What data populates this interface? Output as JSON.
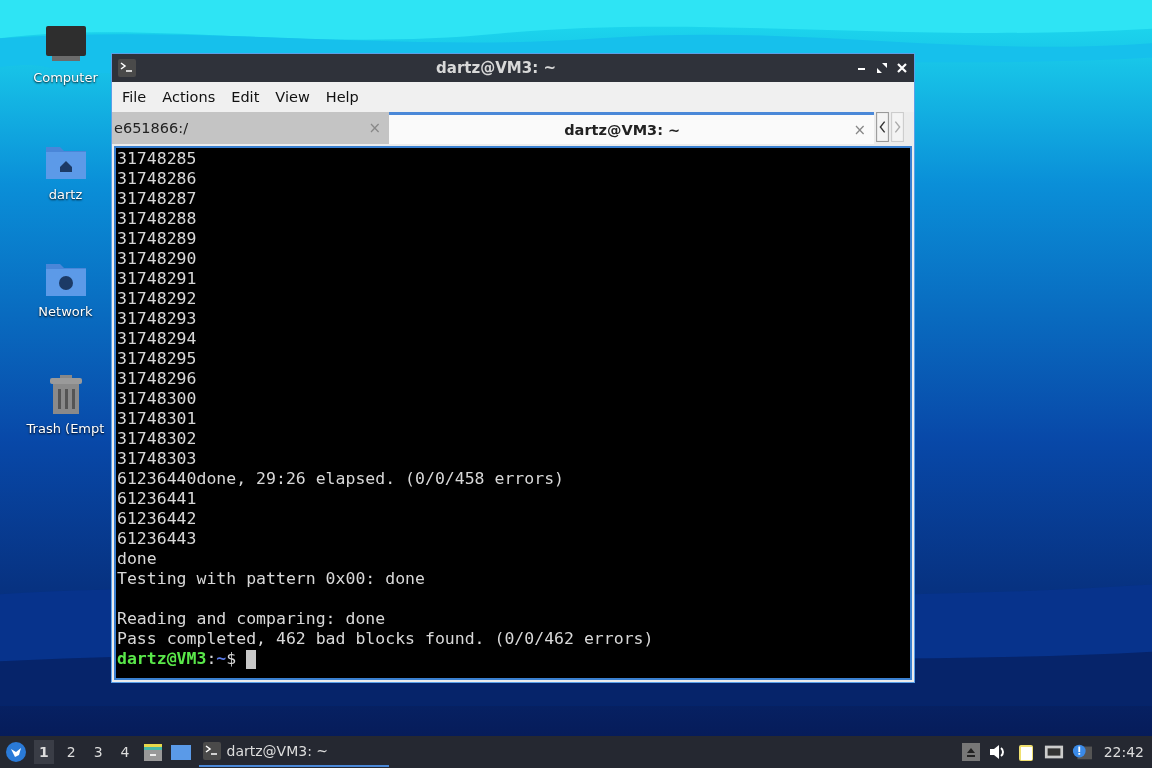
{
  "desktop_icons": [
    {
      "kind": "computer",
      "label": "Computer"
    },
    {
      "kind": "home",
      "label": "dartz"
    },
    {
      "kind": "network",
      "label": "Network"
    },
    {
      "kind": "trash",
      "label": "Trash (Empt"
    }
  ],
  "window": {
    "title": "dartz@VM3: ~",
    "menu": [
      "File",
      "Actions",
      "Edit",
      "View",
      "Help"
    ],
    "tabs": [
      {
        "label": "e651866:/",
        "close": "×",
        "selected": false
      },
      {
        "label": "dartz@VM3: ~",
        "close": "×",
        "selected": true
      }
    ],
    "terminal": {
      "output_blocks": [
        [
          "31748285",
          "31748286",
          "31748287",
          "31748288",
          "31748289",
          "31748290",
          "31748291",
          "31748292",
          "31748293",
          "31748294",
          "31748295",
          "31748296",
          "31748300",
          "31748301",
          "31748302",
          "31748303",
          "61236440done, 29:26 elapsed. (0/0/458 errors)",
          "61236441",
          "61236442",
          "61236443",
          "done",
          "Testing with pattern 0x00: done"
        ],
        [
          "Reading and comparing: done",
          "Pass completed, 462 bad blocks found. (0/0/462 errors)"
        ]
      ],
      "prompt": {
        "user_host": "dartz@VM3",
        "separator": ":",
        "path": "~",
        "symbol": "$"
      }
    }
  },
  "taskbar": {
    "workspaces": [
      {
        "label": "1",
        "selected": true
      },
      {
        "label": "2",
        "selected": false
      },
      {
        "label": "3",
        "selected": false
      },
      {
        "label": "4",
        "selected": false
      }
    ],
    "tasks": [
      {
        "label": "dartz@VM3: ~",
        "selected": true
      }
    ],
    "clock": "22:42"
  }
}
